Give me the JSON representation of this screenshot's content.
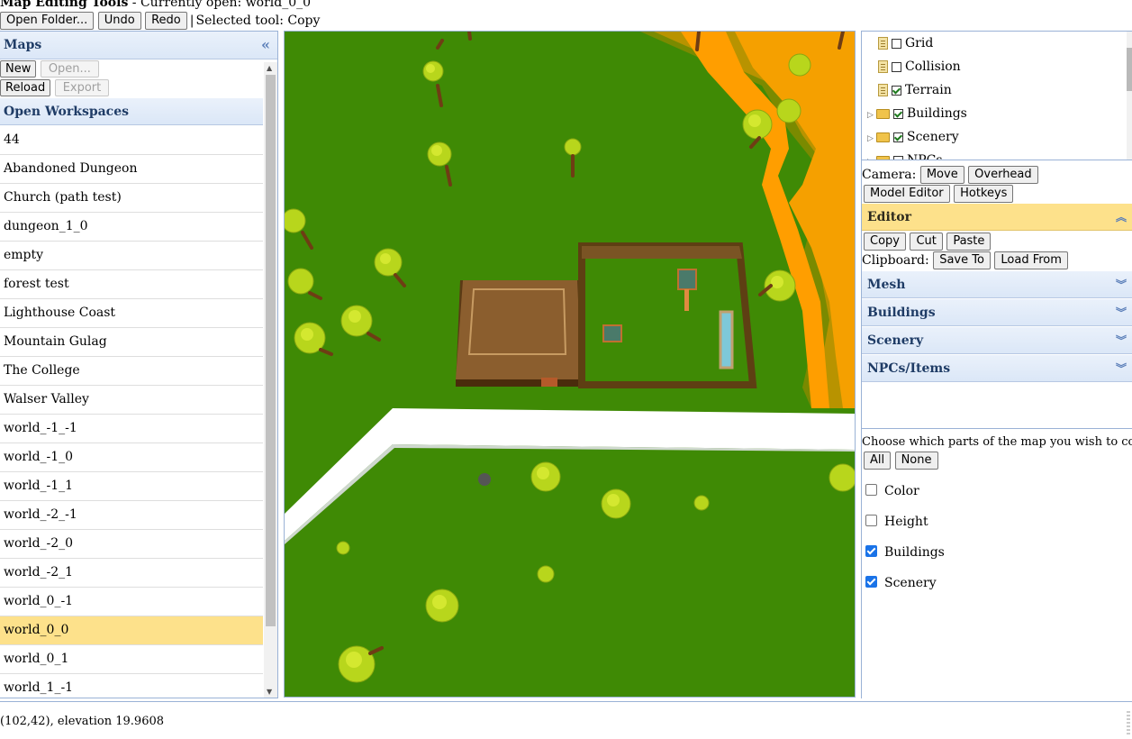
{
  "title": {
    "app": "Map Editing Tools",
    "separator": " - Currently open: ",
    "current": "world_0_0"
  },
  "toolbar": {
    "open_folder": "Open Folder...",
    "undo": "Undo",
    "redo": "Redo",
    "selected_tool": "Selected tool: Copy"
  },
  "maps_panel": {
    "title": "Maps",
    "collapse_icon": "«",
    "new": "New",
    "open": "Open...",
    "reload": "Reload",
    "export": "Export",
    "workspaces_title": "Open Workspaces",
    "items": [
      "44",
      "Abandoned Dungeon",
      "Church (path test)",
      "dungeon_1_0",
      "empty",
      "forest test",
      "Lighthouse Coast",
      "Mountain Gulag",
      "The College",
      "Walser Valley",
      "world_-1_-1",
      "world_-1_0",
      "world_-1_1",
      "world_-2_-1",
      "world_-2_0",
      "world_-2_1",
      "world_0_-1",
      "world_0_0",
      "world_0_1",
      "world_1_-1"
    ],
    "selected": "world_0_0"
  },
  "layers": [
    {
      "label": "Grid",
      "type": "file",
      "checked": false
    },
    {
      "label": "Collision",
      "type": "file",
      "checked": false
    },
    {
      "label": "Terrain",
      "type": "file",
      "checked": true
    },
    {
      "label": "Buildings",
      "type": "folder",
      "checked": true
    },
    {
      "label": "Scenery",
      "type": "folder",
      "checked": true
    },
    {
      "label": "NPCs",
      "type": "folder",
      "checked": false
    }
  ],
  "camera": {
    "label": "Camera:",
    "move": "Move",
    "overhead": "Overhead",
    "model_editor": "Model Editor",
    "hotkeys": "Hotkeys"
  },
  "editor": {
    "title": "Editor",
    "copy": "Copy",
    "cut": "Cut",
    "paste": "Paste",
    "clipboard_label": "Clipboard:",
    "save_to": "Save To",
    "load_from": "Load From",
    "sections": [
      "Mesh",
      "Buildings",
      "Scenery",
      "NPCs/Items"
    ]
  },
  "copy_options": {
    "instructions": "Choose which parts of the map you wish to copy.",
    "all": "All",
    "none": "None",
    "options": [
      {
        "label": "Color",
        "checked": false
      },
      {
        "label": "Height",
        "checked": false
      },
      {
        "label": "Buildings",
        "checked": true
      },
      {
        "label": "Scenery",
        "checked": true
      }
    ]
  },
  "status": {
    "text": "(102,42), elevation 19.9608"
  },
  "colors": {
    "grass": "#3f8a05",
    "sand": "#f5a000",
    "path": "#ffffff",
    "wall": "#6b4a1e",
    "roof": "#8b5e2e",
    "selected_row": "#fde18b"
  }
}
